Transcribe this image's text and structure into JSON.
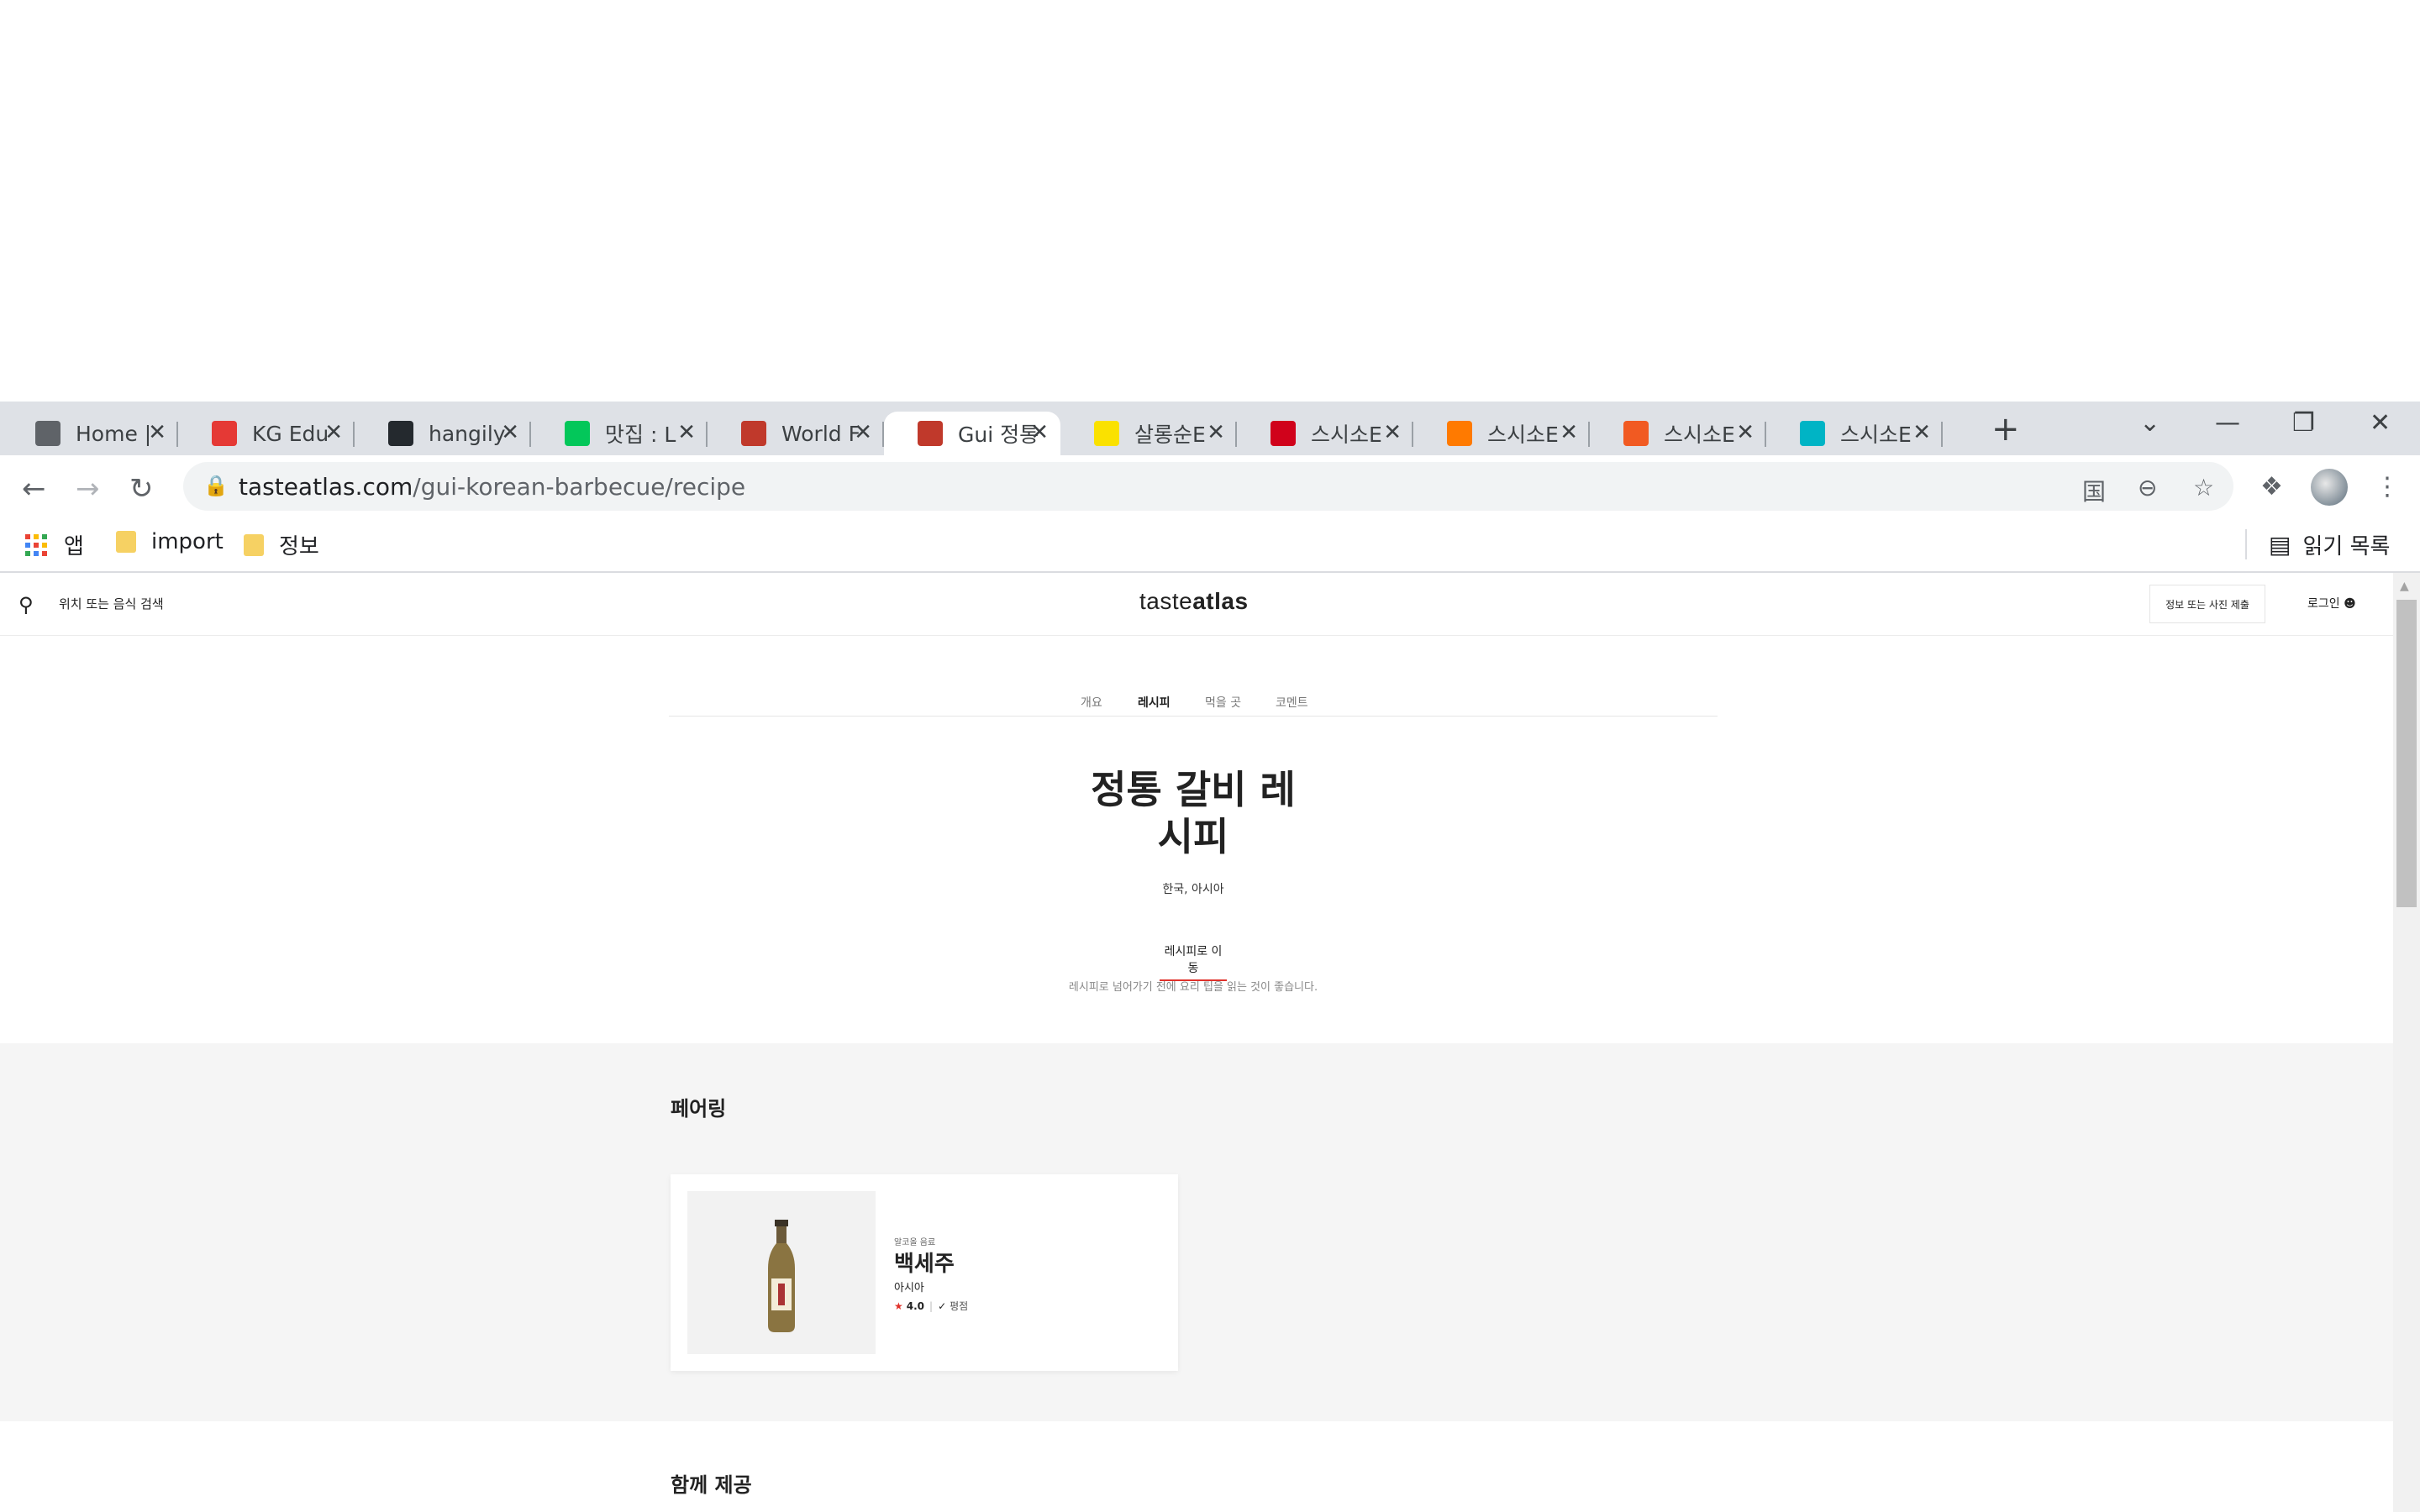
{
  "browser": {
    "tabs": [
      {
        "title": "Home |",
        "icon": "globe-icon",
        "color": "#5f6368",
        "active": false
      },
      {
        "title": "KG Edu",
        "icon": "kg-education-icon",
        "color": "#e53935",
        "active": false
      },
      {
        "title": "hangily",
        "icon": "github-icon",
        "color": "#24292e",
        "active": false
      },
      {
        "title": "맛집 : L",
        "icon": "naver-icon",
        "color": "#03c75a",
        "active": false
      },
      {
        "title": "World F",
        "icon": "tasteatlas-icon",
        "color": "#c0392b",
        "active": false
      },
      {
        "title": "Gui 정통",
        "icon": "tasteatlas-icon",
        "color": "#c0392b",
        "active": true
      },
      {
        "title": "살롱순E",
        "icon": "kakaomap-icon",
        "color": "#fae100",
        "active": false
      },
      {
        "title": "스시소E",
        "icon": "p-icon",
        "color": "#d0021b",
        "active": false
      },
      {
        "title": "스시소E",
        "icon": "orange-m-icon",
        "color": "#ff7a00",
        "active": false
      },
      {
        "title": "스시소E",
        "icon": "siksin-icon",
        "color": "#f15a22",
        "active": false
      },
      {
        "title": "스시소E",
        "icon": "dining-code-icon",
        "color": "#00b4c5",
        "active": false
      }
    ],
    "url_host": "tasteatlas.com",
    "url_path": "/gui-korean-barbecue/recipe",
    "bookmarks": [
      {
        "label": "앱",
        "type": "apps"
      },
      {
        "label": "import",
        "type": "folder"
      },
      {
        "label": "정보",
        "type": "folder"
      }
    ],
    "reading_list": "읽기 목록"
  },
  "site": {
    "search_placeholder": "위치 또는 음식 검색",
    "logo_part1": "taste",
    "logo_part2": "atlas",
    "submit_button": "정보 또는 사진 제출",
    "login": "로그인"
  },
  "subnav": [
    {
      "label": "개요",
      "active": false
    },
    {
      "label": "레시피",
      "active": true
    },
    {
      "label": "먹을 곳",
      "active": false
    },
    {
      "label": "코멘트",
      "active": false
    }
  ],
  "recipe": {
    "title_line1": "정통 갈비 레",
    "title_line2": "시피",
    "region": "한국, 아시아",
    "goto_label": "레시피로 이동",
    "goto_sub": "레시피로 넘어가기 전에 요리 팁을 읽는 것이 좋습니다."
  },
  "pairing": {
    "section_title": "페어링",
    "card": {
      "kicker": "알코올 음료",
      "name": "백세주",
      "origin": "아시아",
      "rating": "4.0",
      "rating_label": "평점"
    }
  },
  "served_with": {
    "section_title": "함께 제공"
  }
}
